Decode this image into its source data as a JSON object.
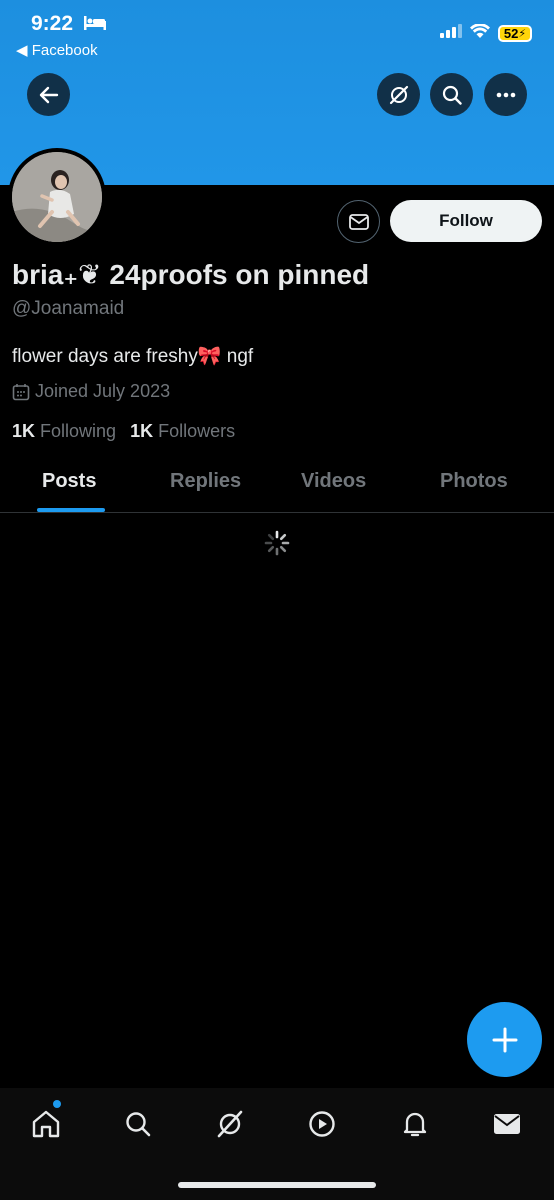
{
  "status_bar": {
    "time": "9:22",
    "back_app": "◀ Facebook",
    "battery": "52"
  },
  "profile": {
    "display_name": "bria₊❦ 24proofs on pinned",
    "handle": "@Joanamaid",
    "bio": "flower days are freshy🎀 ngf",
    "joined": "Joined July 2023",
    "following_count": "1K",
    "following_label": "Following",
    "followers_count": "1K",
    "followers_label": "Followers"
  },
  "actions": {
    "follow_label": "Follow"
  },
  "tabs": [
    {
      "label": "Posts",
      "active": true
    },
    {
      "label": "Replies",
      "active": false
    },
    {
      "label": "Videos",
      "active": false
    },
    {
      "label": "Photos",
      "active": false
    }
  ],
  "bottom_nav": [
    "home-icon",
    "search-icon",
    "grok-icon",
    "video-icon",
    "notifications-icon",
    "messages-icon"
  ],
  "colors": {
    "accent": "#1d9bf0",
    "banner": "#2196e8",
    "battery": "#ffd60a"
  }
}
